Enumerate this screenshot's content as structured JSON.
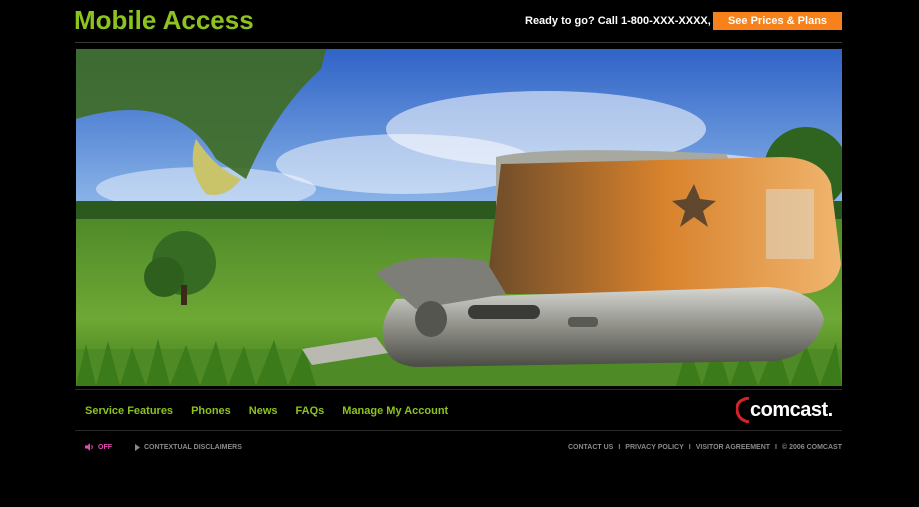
{
  "header": {
    "title": "Mobile Access",
    "cta_text": "Ready to go? Call 1-800-XXX-XXXX, or",
    "cta_button": "See Prices & Plans"
  },
  "nav": {
    "items": [
      "Service Features",
      "Phones",
      "News",
      "FAQs",
      "Manage My Account"
    ]
  },
  "logo": {
    "text": "comcast."
  },
  "bottom": {
    "sound_label": "OFF",
    "disclaimer_label": "CONTEXTUAL DISCLAIMERS",
    "links": [
      "CONTACT US",
      "PRIVACY POLICY",
      "VISITOR AGREEMENT"
    ],
    "copyright": "© 2006 COMCAST",
    "separator": "I"
  },
  "colors": {
    "brand_green": "#8dc21f",
    "cta_orange": "#f7821b",
    "sound_pink": "#e34bb3"
  }
}
